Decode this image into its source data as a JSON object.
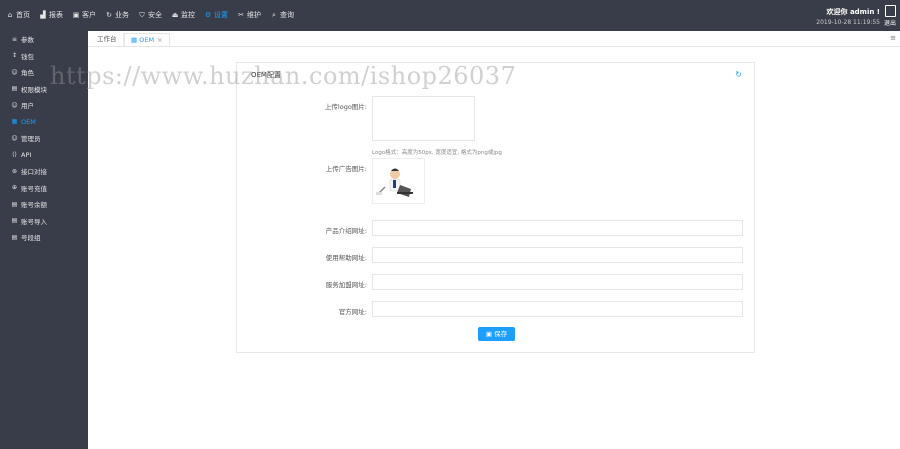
{
  "nav": {
    "items": [
      {
        "label": "首页",
        "icon": "home-icon",
        "glyph": "⌂",
        "active": false
      },
      {
        "label": "报表",
        "icon": "chart-icon",
        "glyph": "▟",
        "active": false
      },
      {
        "label": "客户",
        "icon": "user-card-icon",
        "glyph": "▣",
        "active": false
      },
      {
        "label": "业务",
        "icon": "refresh-icon",
        "glyph": "↻",
        "active": false
      },
      {
        "label": "安全",
        "icon": "shield-icon",
        "glyph": "⛉",
        "active": false
      },
      {
        "label": "监控",
        "icon": "monitor-icon",
        "glyph": "⏏",
        "active": false
      },
      {
        "label": "设置",
        "icon": "gear-icon",
        "glyph": "⚙",
        "active": true
      },
      {
        "label": "维护",
        "icon": "tools-icon",
        "glyph": "✂",
        "active": false
      },
      {
        "label": "查询",
        "icon": "search-icon",
        "glyph": "⌕",
        "active": false
      }
    ],
    "welcome": "欢迎你 admin !",
    "datetime": "2019-10-28 11:19:55",
    "logout": "退出"
  },
  "sidebar": {
    "items": [
      {
        "label": "参数",
        "icon": "sliders-icon",
        "glyph": "≡",
        "active": false
      },
      {
        "label": "钱包",
        "icon": "wallet-icon",
        "glyph": "↕",
        "active": false
      },
      {
        "label": "角色",
        "icon": "role-icon",
        "glyph": "☺",
        "active": false
      },
      {
        "label": "权限模块",
        "icon": "module-icon",
        "glyph": "▤",
        "active": false
      },
      {
        "label": "用户",
        "icon": "user-icon",
        "glyph": "☺",
        "active": false
      },
      {
        "label": "OEM",
        "icon": "oem-icon",
        "glyph": "▦",
        "active": true
      },
      {
        "label": "管理员",
        "icon": "admin-icon",
        "glyph": "☺",
        "active": false
      },
      {
        "label": "API",
        "icon": "api-icon",
        "glyph": "⟨⟩",
        "active": false
      },
      {
        "label": "接口对接",
        "icon": "interface-icon",
        "glyph": "⊛",
        "active": false
      },
      {
        "label": "账号充值",
        "icon": "recharge-icon",
        "glyph": "⊕",
        "active": false
      },
      {
        "label": "账号余额",
        "icon": "balance-icon",
        "glyph": "▤",
        "active": false
      },
      {
        "label": "账号导入",
        "icon": "import-icon",
        "glyph": "▤",
        "active": false
      },
      {
        "label": "号段组",
        "icon": "segment-icon",
        "glyph": "▤",
        "active": false
      }
    ]
  },
  "tabs": {
    "workbench": "工作台",
    "oem": "OEM",
    "close": "×",
    "more": "≡"
  },
  "panel": {
    "title": "OEM配置",
    "labels": {
      "logo": "上传logo图片:",
      "ad": "上传广告图片:",
      "company_url": "产品介绍网址:",
      "help_url": "使用帮助网址:",
      "download_url": "服务加盟网址:",
      "website_url": "官方网址:"
    },
    "hint": "Logo格式：高度为50px, 宽度适宜, 格式为png或jpg",
    "save": "保存"
  },
  "watermark": "https://www.huzhan.com/ishop26037"
}
